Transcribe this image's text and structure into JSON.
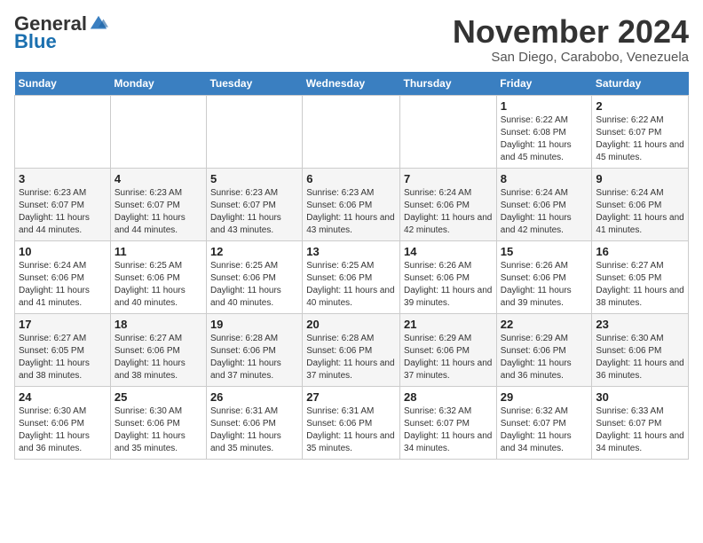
{
  "logo": {
    "general": "General",
    "blue": "Blue"
  },
  "header": {
    "month": "November 2024",
    "location": "San Diego, Carabobo, Venezuela"
  },
  "weekdays": [
    "Sunday",
    "Monday",
    "Tuesday",
    "Wednesday",
    "Thursday",
    "Friday",
    "Saturday"
  ],
  "weeks": [
    [
      {
        "day": "",
        "info": ""
      },
      {
        "day": "",
        "info": ""
      },
      {
        "day": "",
        "info": ""
      },
      {
        "day": "",
        "info": ""
      },
      {
        "day": "",
        "info": ""
      },
      {
        "day": "1",
        "info": "Sunrise: 6:22 AM\nSunset: 6:08 PM\nDaylight: 11 hours and 45 minutes."
      },
      {
        "day": "2",
        "info": "Sunrise: 6:22 AM\nSunset: 6:07 PM\nDaylight: 11 hours and 45 minutes."
      }
    ],
    [
      {
        "day": "3",
        "info": "Sunrise: 6:23 AM\nSunset: 6:07 PM\nDaylight: 11 hours and 44 minutes."
      },
      {
        "day": "4",
        "info": "Sunrise: 6:23 AM\nSunset: 6:07 PM\nDaylight: 11 hours and 44 minutes."
      },
      {
        "day": "5",
        "info": "Sunrise: 6:23 AM\nSunset: 6:07 PM\nDaylight: 11 hours and 43 minutes."
      },
      {
        "day": "6",
        "info": "Sunrise: 6:23 AM\nSunset: 6:06 PM\nDaylight: 11 hours and 43 minutes."
      },
      {
        "day": "7",
        "info": "Sunrise: 6:24 AM\nSunset: 6:06 PM\nDaylight: 11 hours and 42 minutes."
      },
      {
        "day": "8",
        "info": "Sunrise: 6:24 AM\nSunset: 6:06 PM\nDaylight: 11 hours and 42 minutes."
      },
      {
        "day": "9",
        "info": "Sunrise: 6:24 AM\nSunset: 6:06 PM\nDaylight: 11 hours and 41 minutes."
      }
    ],
    [
      {
        "day": "10",
        "info": "Sunrise: 6:24 AM\nSunset: 6:06 PM\nDaylight: 11 hours and 41 minutes."
      },
      {
        "day": "11",
        "info": "Sunrise: 6:25 AM\nSunset: 6:06 PM\nDaylight: 11 hours and 40 minutes."
      },
      {
        "day": "12",
        "info": "Sunrise: 6:25 AM\nSunset: 6:06 PM\nDaylight: 11 hours and 40 minutes."
      },
      {
        "day": "13",
        "info": "Sunrise: 6:25 AM\nSunset: 6:06 PM\nDaylight: 11 hours and 40 minutes."
      },
      {
        "day": "14",
        "info": "Sunrise: 6:26 AM\nSunset: 6:06 PM\nDaylight: 11 hours and 39 minutes."
      },
      {
        "day": "15",
        "info": "Sunrise: 6:26 AM\nSunset: 6:06 PM\nDaylight: 11 hours and 39 minutes."
      },
      {
        "day": "16",
        "info": "Sunrise: 6:27 AM\nSunset: 6:05 PM\nDaylight: 11 hours and 38 minutes."
      }
    ],
    [
      {
        "day": "17",
        "info": "Sunrise: 6:27 AM\nSunset: 6:05 PM\nDaylight: 11 hours and 38 minutes."
      },
      {
        "day": "18",
        "info": "Sunrise: 6:27 AM\nSunset: 6:06 PM\nDaylight: 11 hours and 38 minutes."
      },
      {
        "day": "19",
        "info": "Sunrise: 6:28 AM\nSunset: 6:06 PM\nDaylight: 11 hours and 37 minutes."
      },
      {
        "day": "20",
        "info": "Sunrise: 6:28 AM\nSunset: 6:06 PM\nDaylight: 11 hours and 37 minutes."
      },
      {
        "day": "21",
        "info": "Sunrise: 6:29 AM\nSunset: 6:06 PM\nDaylight: 11 hours and 37 minutes."
      },
      {
        "day": "22",
        "info": "Sunrise: 6:29 AM\nSunset: 6:06 PM\nDaylight: 11 hours and 36 minutes."
      },
      {
        "day": "23",
        "info": "Sunrise: 6:30 AM\nSunset: 6:06 PM\nDaylight: 11 hours and 36 minutes."
      }
    ],
    [
      {
        "day": "24",
        "info": "Sunrise: 6:30 AM\nSunset: 6:06 PM\nDaylight: 11 hours and 36 minutes."
      },
      {
        "day": "25",
        "info": "Sunrise: 6:30 AM\nSunset: 6:06 PM\nDaylight: 11 hours and 35 minutes."
      },
      {
        "day": "26",
        "info": "Sunrise: 6:31 AM\nSunset: 6:06 PM\nDaylight: 11 hours and 35 minutes."
      },
      {
        "day": "27",
        "info": "Sunrise: 6:31 AM\nSunset: 6:06 PM\nDaylight: 11 hours and 35 minutes."
      },
      {
        "day": "28",
        "info": "Sunrise: 6:32 AM\nSunset: 6:07 PM\nDaylight: 11 hours and 34 minutes."
      },
      {
        "day": "29",
        "info": "Sunrise: 6:32 AM\nSunset: 6:07 PM\nDaylight: 11 hours and 34 minutes."
      },
      {
        "day": "30",
        "info": "Sunrise: 6:33 AM\nSunset: 6:07 PM\nDaylight: 11 hours and 34 minutes."
      }
    ]
  ]
}
